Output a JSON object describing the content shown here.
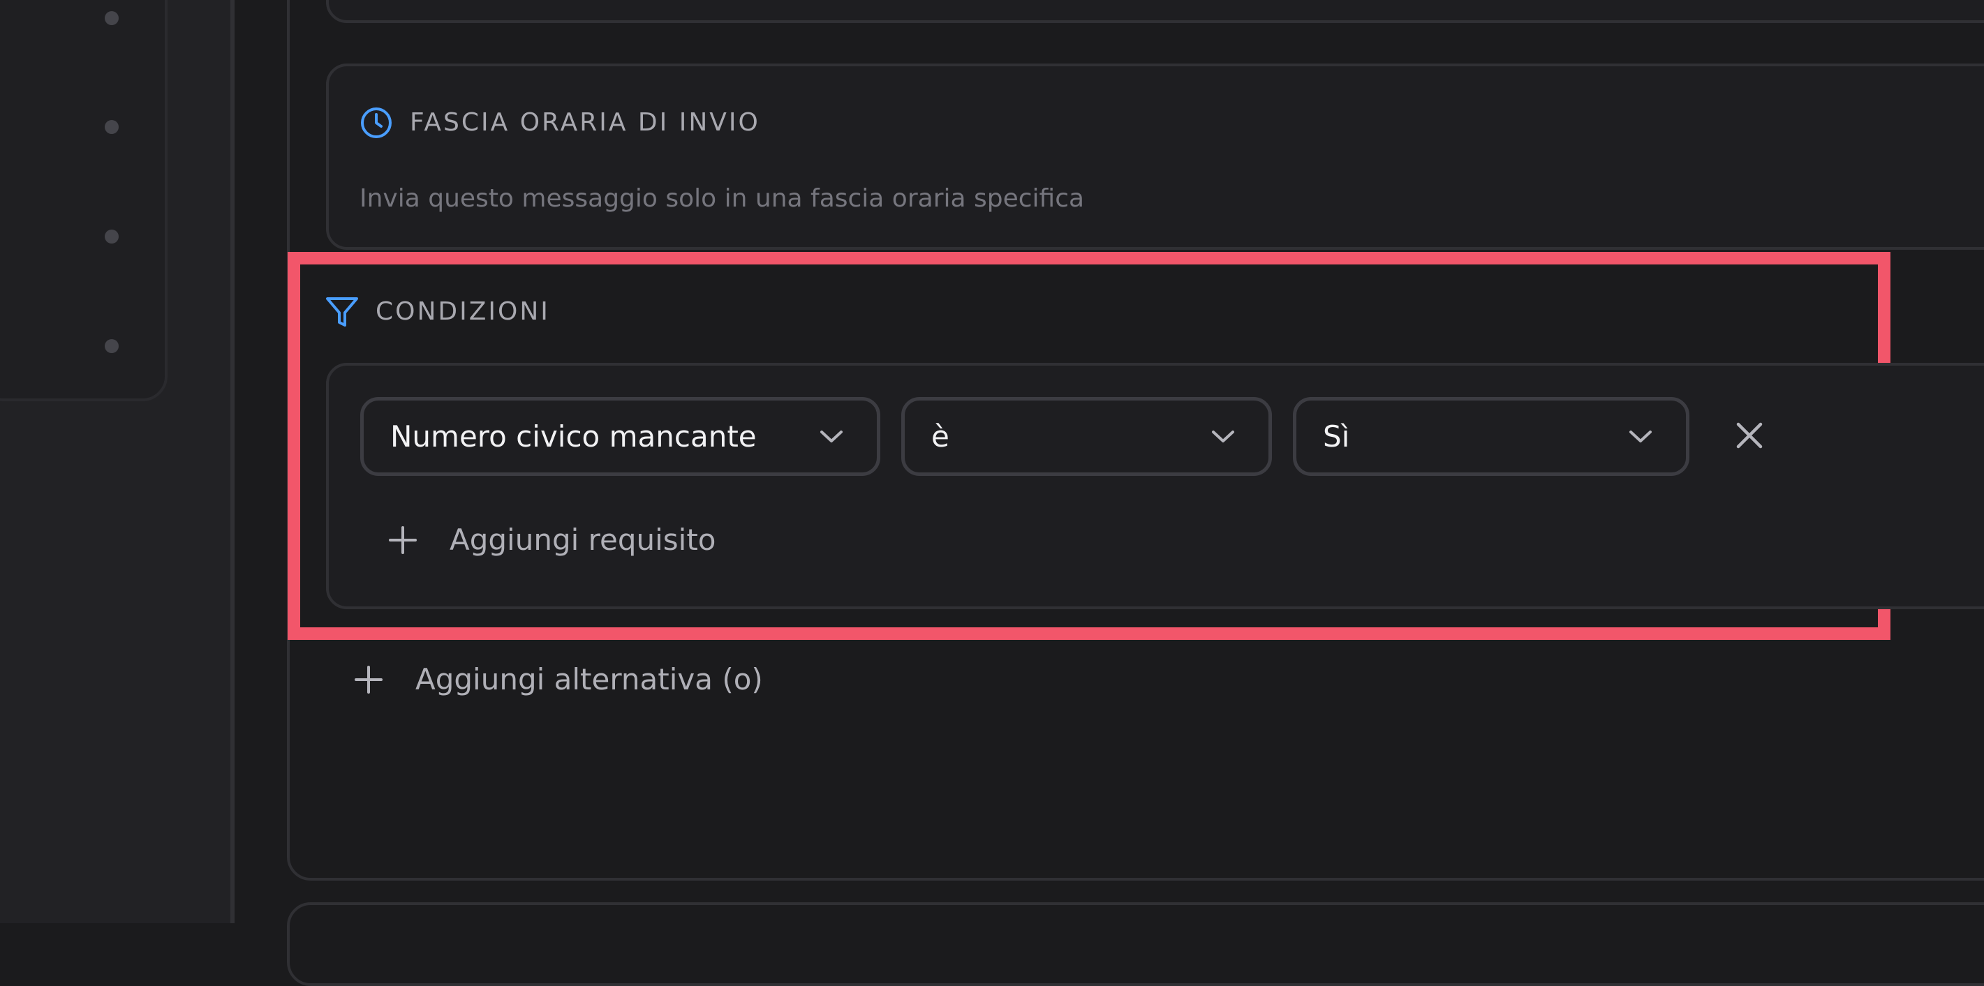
{
  "time_window": {
    "title": "FASCIA ORARIA DI INVIO",
    "description": "Invia questo messaggio solo in una fascia oraria specifica",
    "icon": "clock-icon"
  },
  "conditions": {
    "title": "CONDIZIONI",
    "icon": "filter-icon",
    "requirement": {
      "field": "Numero civico mancante",
      "operator": "è",
      "value": "Sì"
    },
    "add_requirement_label": "Aggiungi requisito"
  },
  "add_alternative_label": "Aggiungi alternativa (o)",
  "colors": {
    "accent_blue": "#4a9eff",
    "highlight": "#f2566a",
    "background": "#1b1b1d"
  }
}
